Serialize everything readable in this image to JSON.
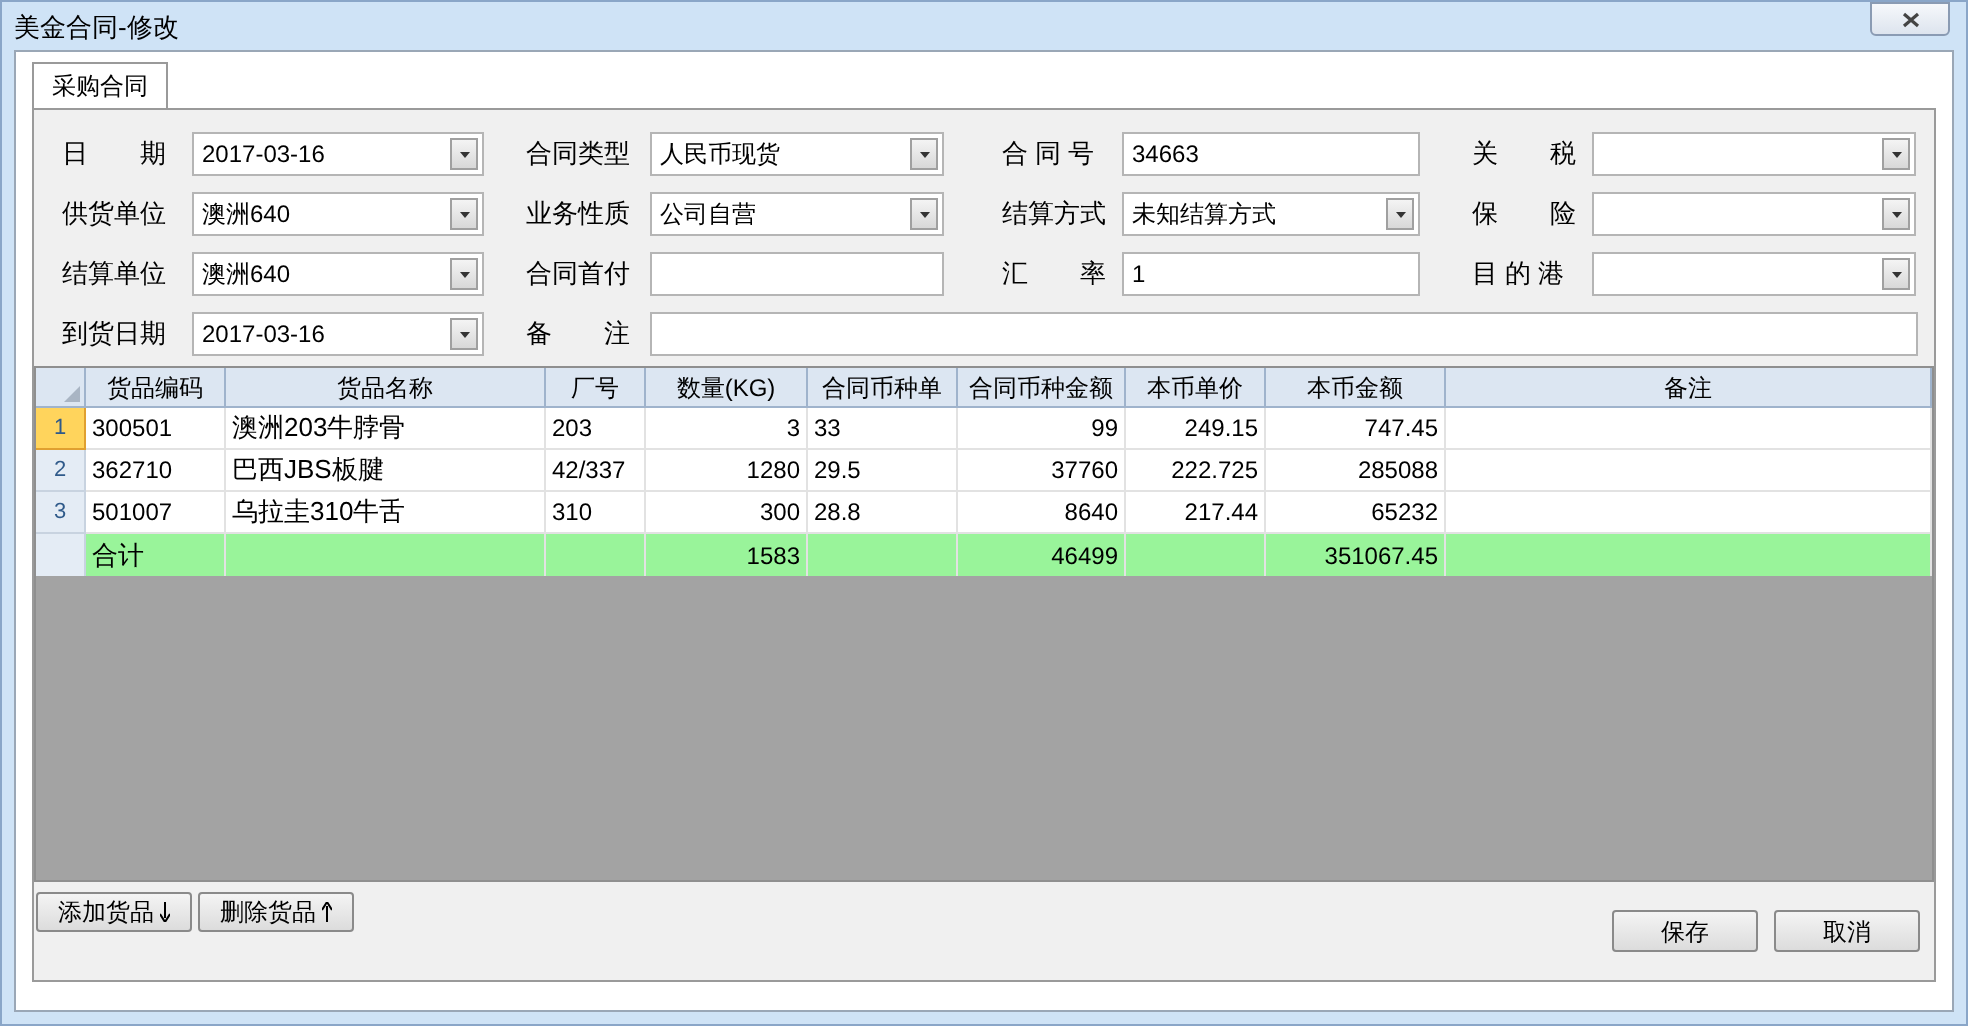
{
  "window": {
    "title": "美金合同-修改"
  },
  "tabs": [
    {
      "label": "采购合同",
      "selected": true
    }
  ],
  "form": {
    "rows": [
      [
        {
          "label": "日　　期",
          "kind": "combo",
          "value": "2017-03-16"
        },
        {
          "label": "合同类型",
          "kind": "combo",
          "value": "人民币现货"
        },
        {
          "label": "合 同 号",
          "kind": "text",
          "value": "34663"
        },
        {
          "label": "关　　税",
          "kind": "combo"
        }
      ],
      [
        {
          "label": "供货单位",
          "kind": "combo",
          "value": "澳洲640"
        },
        {
          "label": "业务性质",
          "kind": "combo",
          "value": "公司自营"
        },
        {
          "label": "结算方式",
          "kind": "combo",
          "value": "未知结算方式"
        },
        {
          "label": "保　　险",
          "kind": "combo"
        }
      ],
      [
        {
          "label": "结算单位",
          "kind": "combo",
          "value": "澳洲640"
        },
        {
          "label": "合同首付",
          "kind": "text"
        },
        {
          "label": "汇　　率",
          "kind": "text",
          "value": "1"
        },
        {
          "label": "目 的 港",
          "kind": "combo"
        }
      ],
      [
        {
          "label": "到货日期",
          "kind": "combo",
          "value": "2017-03-16"
        },
        {
          "label": "备　　注",
          "kind": "text"
        }
      ]
    ]
  },
  "table": {
    "columns": [
      "货品编码",
      "货品名称",
      "厂号",
      "数量(KG)",
      "合同币种单",
      "合同币种金额",
      "本币单价",
      "本币金额",
      "备注"
    ],
    "rows": [
      {
        "number": "1",
        "selected": true,
        "cells": [
          "300501",
          "澳洲203牛脖骨",
          "203",
          "3",
          "33",
          "99",
          "249.15",
          "747.45",
          ""
        ]
      },
      {
        "number": "2",
        "selected": false,
        "cells": [
          "362710",
          "巴西JBS板腱",
          "42/337",
          "1280",
          "29.5",
          "37760",
          "222.725",
          "285088",
          ""
        ]
      },
      {
        "number": "3",
        "selected": false,
        "cells": [
          "501007",
          "乌拉圭310牛舌",
          "310",
          "300",
          "28.8",
          "8640",
          "217.44",
          "65232",
          ""
        ]
      }
    ],
    "total": {
      "cells": [
        "合计",
        "",
        "",
        "1583",
        "",
        "46499",
        "",
        "351067.45",
        ""
      ]
    }
  },
  "buttons": {
    "left": [
      {
        "label": "添加货品",
        "kind": "add"
      },
      {
        "label": "删除货品",
        "kind": "remove"
      }
    ],
    "right": [
      "保存",
      "取消"
    ]
  }
}
